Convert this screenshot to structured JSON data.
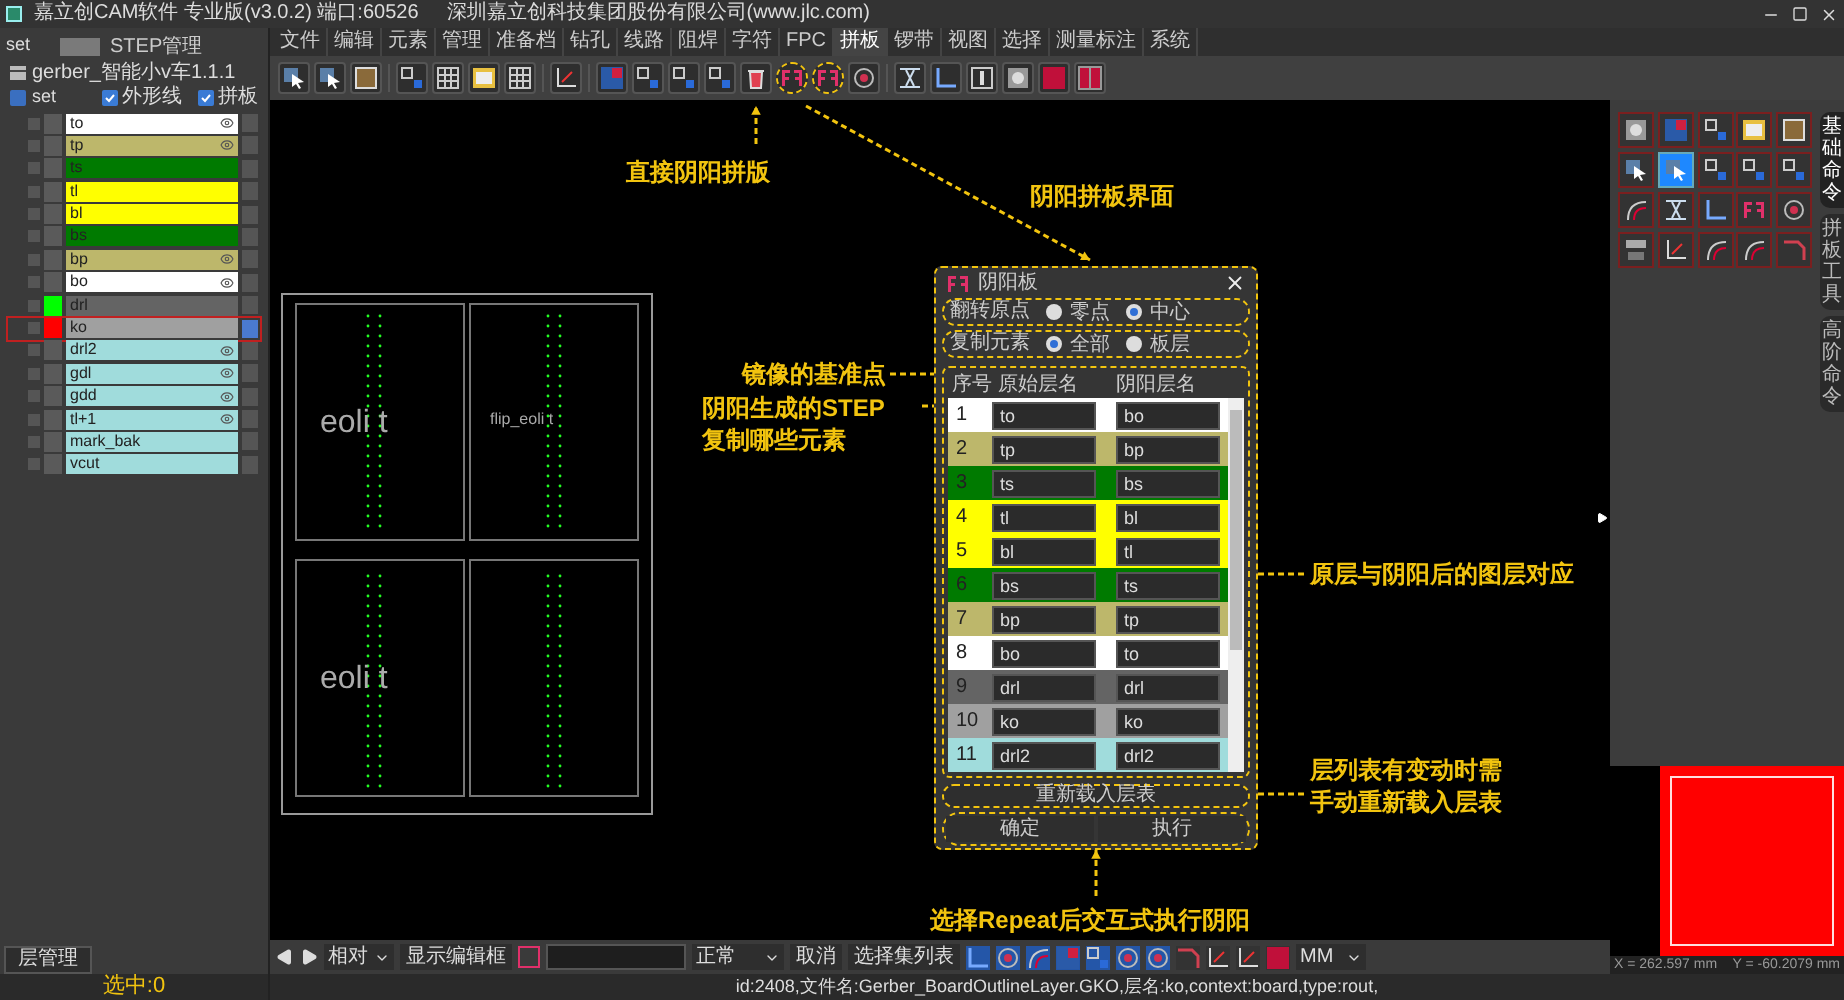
{
  "window": {
    "title": "嘉立创CAM软件 专业版(v3.0.2) 端口:60526",
    "company": "深圳嘉立创科技集团股份有限公司(www.jlc.com)"
  },
  "left_panel": {
    "step_label": "set",
    "step_button": "STEP管理",
    "job": "gerber_智能小v车1.1.1",
    "step": "set",
    "options": [
      {
        "label": "外形线",
        "checked": true
      },
      {
        "label": "拼板",
        "checked": true
      }
    ],
    "layers": [
      {
        "name": "to",
        "color": "#ffffff",
        "swatch": {
          "color": "#5a5a5a"
        },
        "visible": true,
        "selected": false
      },
      {
        "name": "tp",
        "color": "#bdb76b",
        "swatch": {
          "color": "#5a5a5a"
        },
        "visible": true,
        "selected": false
      },
      {
        "name": "ts",
        "color": "#007a00",
        "swatch": {
          "color": "#5a5a5a"
        },
        "visible": false,
        "selected": false
      },
      {
        "name": "tl",
        "color": "#ffff00",
        "swatch": {
          "color": "#5a5a5a"
        },
        "visible": false,
        "selected": false
      },
      {
        "name": "bl",
        "color": "#ffff00",
        "swatch": {
          "color": "#5a5a5a"
        },
        "visible": false,
        "selected": false
      },
      {
        "name": "bs",
        "color": "#007a00",
        "swatch": {
          "color": "#5a5a5a"
        },
        "visible": false,
        "selected": false
      },
      {
        "name": "bp",
        "color": "#bdb76b",
        "swatch": {
          "color": "#5a5a5a"
        },
        "visible": true,
        "selected": false
      },
      {
        "name": "bo",
        "color": "#ffffff",
        "swatch": {
          "color": "#5a5a5a"
        },
        "visible": true,
        "selected": false
      },
      {
        "name": "drl",
        "color": "#646464",
        "swatch": {
          "color": "#00ff00"
        },
        "visible": false,
        "selected": false
      },
      {
        "name": "ko",
        "color": "#a0a0a0",
        "swatch": {
          "color": "#ff0000"
        },
        "visible": false,
        "selected": true
      },
      {
        "name": "drl2",
        "color": "#a0dcdc",
        "swatch": {
          "color": "#5a5a5a"
        },
        "visible": true,
        "selected": false
      },
      {
        "name": "gdl",
        "color": "#a0dcdc",
        "swatch": {
          "color": "#5a5a5a"
        },
        "visible": true,
        "selected": false
      },
      {
        "name": "gdd",
        "color": "#a0dcdc",
        "swatch": {
          "color": "#5a5a5a"
        },
        "visible": true,
        "selected": false
      },
      {
        "name": "tl+1",
        "color": "#a0dcdc",
        "swatch": {
          "color": "#5a5a5a"
        },
        "visible": true,
        "selected": false
      },
      {
        "name": "mark_bak",
        "color": "#a0dcdc",
        "swatch": {
          "color": "#5a5a5a"
        },
        "visible": false,
        "selected": false
      },
      {
        "name": "vcut",
        "color": "#a0dcdc",
        "swatch": {
          "color": "#5a5a5a"
        },
        "visible": false,
        "selected": false
      }
    ],
    "tab": "层管理",
    "selection": "选中:0"
  },
  "menu": [
    {
      "label": "文件",
      "selected": false
    },
    {
      "label": "编辑",
      "selected": false
    },
    {
      "label": "元素",
      "selected": false
    },
    {
      "label": "管理",
      "selected": false
    },
    {
      "label": "准备档",
      "selected": false
    },
    {
      "label": "钻孔",
      "selected": false
    },
    {
      "label": "线路",
      "selected": false
    },
    {
      "label": "阻焊",
      "selected": false
    },
    {
      "label": "字符",
      "selected": false
    },
    {
      "label": "FPC",
      "selected": false
    },
    {
      "label": "拼板",
      "selected": true
    },
    {
      "label": "锣带",
      "selected": false
    },
    {
      "label": "视图",
      "selected": false
    },
    {
      "label": "选择",
      "selected": false
    },
    {
      "label": "测量标注",
      "selected": false
    },
    {
      "label": "系统",
      "selected": false
    }
  ],
  "canvas": {
    "board_labels": [
      "eoli t",
      "flip_eoli t",
      "eoli t"
    ],
    "annotations": [
      {
        "lines": [
          "直接阴阳拼版"
        ]
      },
      {
        "lines": [
          "阴阳拼板界面"
        ]
      },
      {
        "lines": [
          "镜像的基准点"
        ]
      },
      {
        "lines": [
          "阴阳生成的STEP",
          "复制哪些元素"
        ]
      },
      {
        "lines": [
          "原层与阴阳后的图层对应"
        ]
      },
      {
        "lines": [
          "层列表有变动时需",
          "手动重新载入层表"
        ]
      },
      {
        "lines": [
          "选择Repeat后交互式执行阴阳"
        ]
      }
    ]
  },
  "dialog": {
    "title": "阴阳板",
    "origin": {
      "label": "翻转原点",
      "options": [
        {
          "label": "零点",
          "selected": false
        },
        {
          "label": "中心",
          "selected": true
        }
      ]
    },
    "copy": {
      "label": "复制元素",
      "options": [
        {
          "label": "全部",
          "selected": true
        },
        {
          "label": "板层",
          "selected": false
        }
      ]
    },
    "columns": [
      "序号",
      "原始层名",
      "阴阳层名"
    ],
    "rows": [
      {
        "index": "1",
        "original": "to",
        "mirror": "bo",
        "color": "#ffffff"
      },
      {
        "index": "2",
        "original": "tp",
        "mirror": "bp",
        "color": "#bdb76b"
      },
      {
        "index": "3",
        "original": "ts",
        "mirror": "bs",
        "color": "#007a00"
      },
      {
        "index": "4",
        "original": "tl",
        "mirror": "bl",
        "color": "#ffff00"
      },
      {
        "index": "5",
        "original": "bl",
        "mirror": "tl",
        "color": "#ffff00"
      },
      {
        "index": "6",
        "original": "bs",
        "mirror": "ts",
        "color": "#007a00"
      },
      {
        "index": "7",
        "original": "bp",
        "mirror": "tp",
        "color": "#bdb76b"
      },
      {
        "index": "8",
        "original": "bo",
        "mirror": "to",
        "color": "#ffffff"
      },
      {
        "index": "9",
        "original": "drl",
        "mirror": "drl",
        "color": "#646464"
      },
      {
        "index": "10",
        "original": "ko",
        "mirror": "ko",
        "color": "#a0a0a0"
      },
      {
        "index": "11",
        "original": "drl2",
        "mirror": "drl2",
        "color": "#a0dcdc"
      }
    ],
    "reload": "重新载入层表",
    "ok": "确定",
    "run": "执行"
  },
  "right_panel": {
    "tools": [
      {
        "selected": false
      },
      {
        "selected": false
      },
      {
        "selected": false
      },
      {
        "selected": false
      },
      {
        "selected": false
      },
      {
        "selected": false
      },
      {
        "selected": true
      },
      {
        "selected": false
      },
      {
        "selected": false
      },
      {
        "selected": false
      },
      {
        "selected": false
      },
      {
        "selected": false
      },
      {
        "selected": false
      },
      {
        "selected": false
      },
      {
        "selected": false
      },
      {
        "selected": false
      },
      {
        "selected": false
      },
      {
        "selected": false
      },
      {
        "selected": false
      },
      {
        "selected": false
      }
    ],
    "tabs": [
      {
        "label": "基础命令",
        "selected": true
      },
      {
        "label": "拼板工具",
        "selected": false
      },
      {
        "label": "高阶命令",
        "selected": false
      }
    ],
    "preview_x": "X = 262.597 mm",
    "preview_y": "Y = -60.2079 mm"
  },
  "bottom_toolbar": {
    "mode": "相对",
    "show_edit": "显示编辑框",
    "style": "正常",
    "cancel": "取消",
    "select_list": "选择集列表",
    "unit": "MM"
  },
  "status_bar": "id:2408,文件名:Gerber_BoardOutlineLayer.GKO,层名:ko,context:board,type:rout,"
}
